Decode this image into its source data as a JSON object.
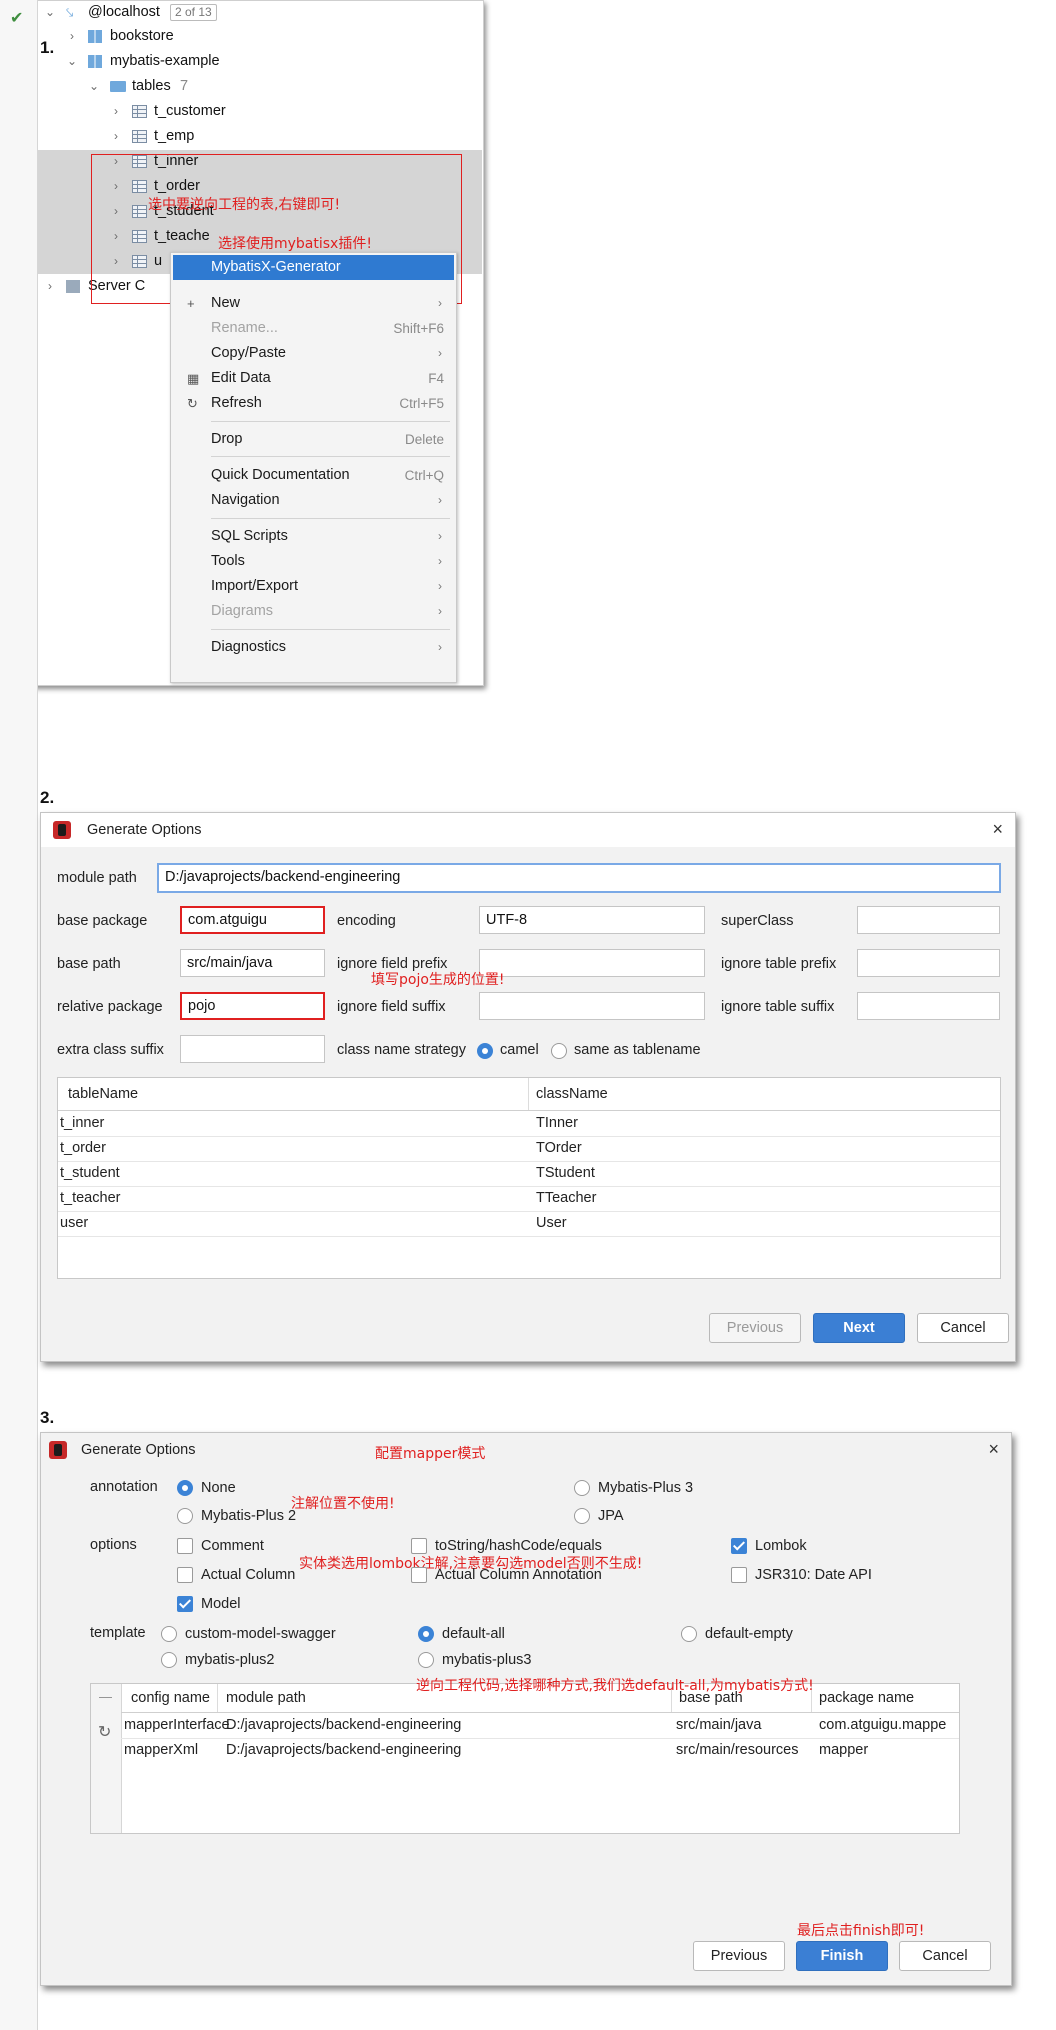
{
  "steps": {
    "s1": "1.",
    "s2": "2.",
    "s3": "3."
  },
  "panel1": {
    "root": {
      "label": "@localhost",
      "badge": "2 of 13"
    },
    "bookstore": "bookstore",
    "mybatis_example": "mybatis-example",
    "tables": {
      "label": "tables",
      "count": "7"
    },
    "rows": [
      "t_customer",
      "t_emp",
      "t_inner",
      "t_order",
      "t_student",
      "t_teache",
      "u"
    ],
    "server": "Server C",
    "annotations": {
      "a1": "选中要逆向工程的表,右键即可!",
      "a2": "选择使用mybatisx插件!"
    },
    "menu": {
      "items": [
        {
          "label": "MybatisX-Generator",
          "shortcut": "",
          "arrow": ""
        },
        {
          "label": "New",
          "shortcut": "",
          "arrow": "›"
        },
        {
          "label": "Rename...",
          "shortcut": "Shift+F6",
          "arrow": ""
        },
        {
          "label": "Copy/Paste",
          "shortcut": "",
          "arrow": "›"
        },
        {
          "label": "Edit Data",
          "shortcut": "F4",
          "arrow": ""
        },
        {
          "label": "Refresh",
          "shortcut": "Ctrl+F5",
          "arrow": ""
        },
        {
          "label": "Drop",
          "shortcut": "Delete",
          "arrow": ""
        },
        {
          "label": "Quick Documentation",
          "shortcut": "Ctrl+Q",
          "arrow": ""
        },
        {
          "label": "Navigation",
          "shortcut": "",
          "arrow": "›"
        },
        {
          "label": "SQL Scripts",
          "shortcut": "",
          "arrow": "›"
        },
        {
          "label": "Tools",
          "shortcut": "",
          "arrow": "›"
        },
        {
          "label": "Import/Export",
          "shortcut": "",
          "arrow": "›"
        },
        {
          "label": "Diagrams",
          "shortcut": "",
          "arrow": "›"
        },
        {
          "label": "Diagnostics",
          "shortcut": "",
          "arrow": "›"
        }
      ]
    }
  },
  "panel2": {
    "title": "Generate Options",
    "close": "×",
    "module_path": {
      "label": "module path",
      "value": "D:/javaprojects/backend-engineering"
    },
    "base_package": {
      "label": "base package",
      "value": "com.atguigu"
    },
    "encoding": {
      "label": "encoding",
      "value": "UTF-8"
    },
    "superclass": {
      "label": "superClass",
      "value": ""
    },
    "base_path": {
      "label": "base path",
      "value": "src/main/java"
    },
    "ignore_field_prefix": {
      "label": "ignore field prefix",
      "value": ""
    },
    "ignore_table_prefix": {
      "label": "ignore table prefix",
      "value": ""
    },
    "relative_package": {
      "label": "relative package",
      "value": "pojo"
    },
    "ignore_field_suffix": {
      "label": "ignore field suffix",
      "value": ""
    },
    "ignore_table_suffix": {
      "label": "ignore table suffix",
      "value": ""
    },
    "extra_class_suffix": {
      "label": "extra class suffix",
      "value": ""
    },
    "class_name_strategy": {
      "label": "class name strategy",
      "opt1": "camel",
      "opt2": "same as tablename"
    },
    "annotation": "填写pojo生成的位置!",
    "table": {
      "headers": [
        "tableName",
        "className"
      ],
      "rows": [
        [
          "t_inner",
          "TInner"
        ],
        [
          "t_order",
          "TOrder"
        ],
        [
          "t_student",
          "TStudent"
        ],
        [
          "t_teacher",
          "TTeacher"
        ],
        [
          "user",
          "User"
        ]
      ]
    },
    "buttons": {
      "previous": "Previous",
      "next": "Next",
      "cancel": "Cancel"
    }
  },
  "panel3": {
    "title": "Generate Options",
    "close": "×",
    "annotations": {
      "a1": "配置mapper模式",
      "a2": "注解位置不使用!",
      "a3": "实体类选用lombok注解,注意要勾选model否则不生成!",
      "a4": "逆向工程代码,选择哪种方式,我们选default-all,为mybatis方式!",
      "a5": "最后点击finish即可!"
    },
    "annotation_label": "annotation",
    "annotation_opts": {
      "none": "None",
      "mp3": "Mybatis-Plus 3",
      "mp2": "Mybatis-Plus 2",
      "jpa": "JPA"
    },
    "options_label": "options",
    "options": {
      "comment": "Comment",
      "tostring": "toString/hashCode/equals",
      "lombok": "Lombok",
      "actual_column": "Actual Column",
      "actual_column_annotation": "Actual Column Annotation",
      "jsr310": "JSR310: Date API",
      "model": "Model"
    },
    "template_label": "template",
    "templates": {
      "swagger": "custom-model-swagger",
      "default_all": "default-all",
      "default_empty": "default-empty",
      "mp2": "mybatis-plus2",
      "mp3": "mybatis-plus3"
    },
    "table": {
      "minus": "—",
      "headers": [
        "config name",
        "module path",
        "base path",
        "package name"
      ],
      "rows": [
        [
          "mapperInterface",
          "D:/javaprojects/backend-engineering",
          "src/main/java",
          "com.atguigu.mappe"
        ],
        [
          "mapperXml",
          "D:/javaprojects/backend-engineering",
          "src/main/resources",
          "mapper"
        ]
      ]
    },
    "buttons": {
      "previous": "Previous",
      "finish": "Finish",
      "cancel": "Cancel"
    }
  }
}
